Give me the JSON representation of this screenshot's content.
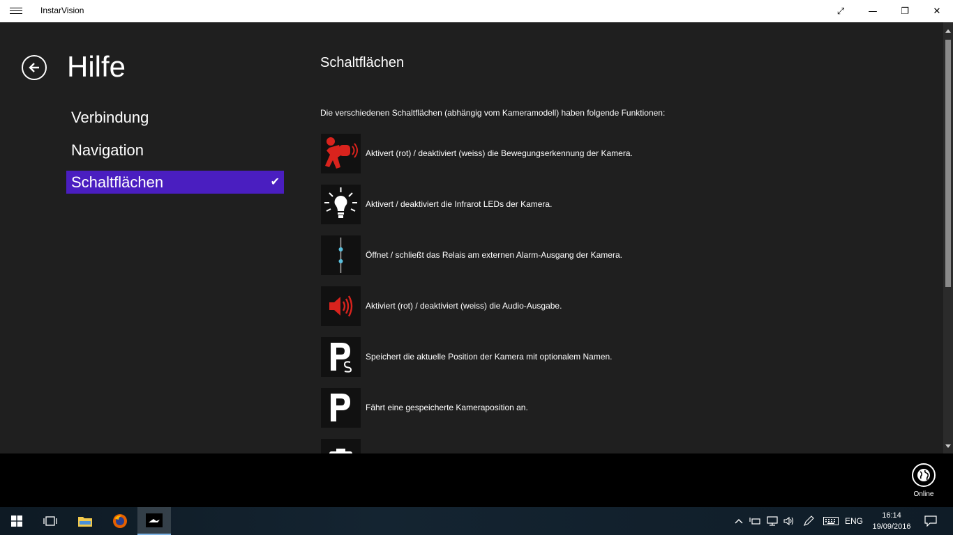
{
  "window": {
    "title": "InstarVision",
    "maximize_icon": "⤢",
    "minimize_icon": "—",
    "restore_icon": "❐",
    "close_icon": "✕"
  },
  "page": {
    "title": "Hilfe"
  },
  "nav": {
    "items": [
      {
        "label": "Verbindung",
        "selected": false
      },
      {
        "label": "Navigation",
        "selected": false
      },
      {
        "label": "Schaltflächen",
        "selected": true
      }
    ],
    "check": "✔"
  },
  "content": {
    "section_title": "Schaltflächen",
    "intro": "Die verschiedenen Schaltflächen (abhängig vom Kameramodell) haben folgende Funktionen:",
    "rows": [
      {
        "icon": "motion-detection-icon",
        "text": "Aktivert (rot) / deaktiviert (weiss) die Bewegungserkennung der Kamera."
      },
      {
        "icon": "infrared-led-icon",
        "text": "Aktivert / deaktiviert die Infrarot LEDs der Kamera."
      },
      {
        "icon": "relay-icon",
        "text": "Öffnet / schließt das Relais am externen Alarm-Ausgang der Kamera."
      },
      {
        "icon": "audio-output-icon",
        "text": "Aktiviert (rot) / deaktiviert (weiss) die Audio-Ausgabe."
      },
      {
        "icon": "save-position-icon",
        "text": "Speichert die aktuelle Position der Kamera mit optionalem Namen."
      },
      {
        "icon": "goto-position-icon",
        "text": "Fährt eine gespeicherte Kameraposition an."
      }
    ]
  },
  "appbar": {
    "online_label": "Online"
  },
  "taskbar": {
    "language": "ENG",
    "time": "16:14",
    "date": "19/09/2016"
  },
  "colors": {
    "accent": "#4a1ec0",
    "background": "#1f1f1f",
    "alert_red": "#d9231d"
  }
}
